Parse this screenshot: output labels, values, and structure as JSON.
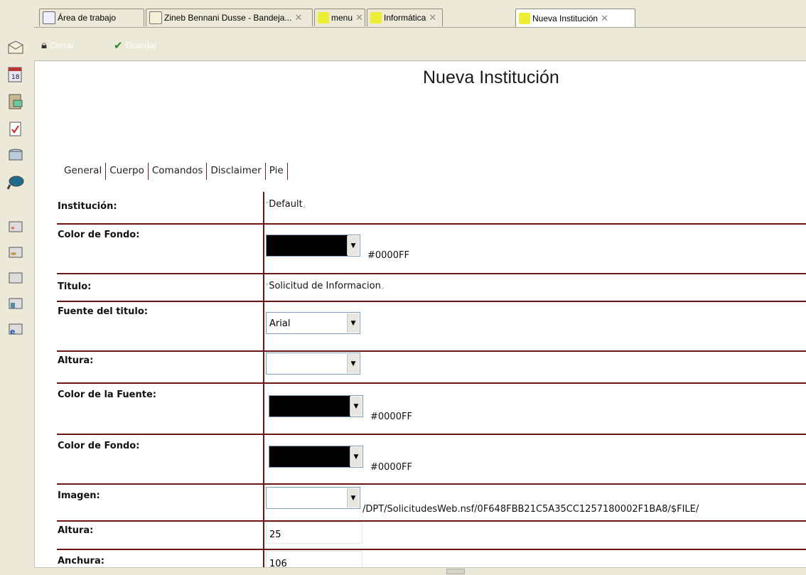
{
  "tabs": [
    {
      "label": "Área de trabajo",
      "closable": false,
      "icon": "workspace-icon",
      "active": false
    },
    {
      "label": "Zineb Bennani Dusse - Bandeja...",
      "closable": true,
      "icon": "mail-icon",
      "active": false
    },
    {
      "label": "menu",
      "closable": true,
      "icon": "db-icon",
      "active": false
    },
    {
      "label": "Informática",
      "closable": true,
      "icon": "db-icon",
      "active": false
    },
    {
      "label": "Nueva Institución",
      "closable": true,
      "icon": "db-icon",
      "active": true
    }
  ],
  "actions": {
    "close_label": "Cerrar",
    "save_label": "Guardar"
  },
  "document": {
    "title": "Nueva Institución"
  },
  "form_tabs": [
    "General",
    "Cuerpo",
    "Comandos",
    "Disclaimer",
    "Pie"
  ],
  "fields": {
    "institucion": {
      "label": "Institución:",
      "value": "Default"
    },
    "color_fondo": {
      "label": "Color de Fondo:",
      "hex": "#0000FF"
    },
    "titulo": {
      "label": "Titulo:",
      "value": "Solicitud de Informacion"
    },
    "fuente_titulo": {
      "label": "Fuente del titulo:",
      "value": "Arial"
    },
    "altura_1": {
      "label": "Altura:",
      "value": ""
    },
    "color_fuente": {
      "label": "Color de la Fuente:",
      "hex": "#0000FF"
    },
    "color_fondo_2": {
      "label": "Color de Fondo:",
      "hex": "#0000FF"
    },
    "imagen": {
      "label": "Imagen:",
      "path": "/DPT/SolicitudesWeb.nsf/0F648FBB21C5A35CC1257180002F1BA8/$FILE/"
    },
    "altura_2": {
      "label": "Altura:",
      "value": "25"
    },
    "anchura": {
      "label": "Anchura:",
      "value": "106"
    }
  },
  "colors": {
    "grid_line": "#6b1515",
    "chrome_bg": "#ece9d8",
    "swatch": "#000000"
  }
}
